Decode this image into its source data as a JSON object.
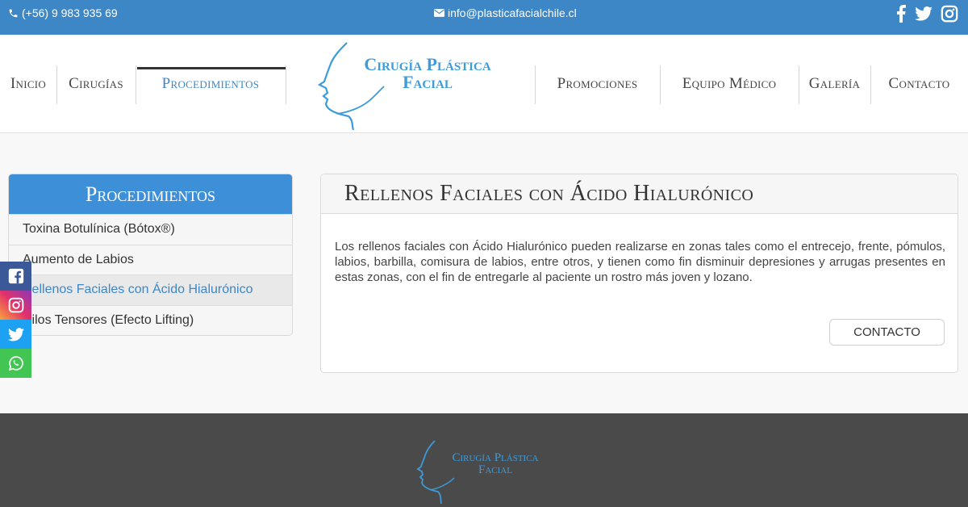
{
  "topbar": {
    "phone": "(+56) 9 983 935 69",
    "email": "info@plasticafacialchile.cl",
    "socials": [
      "facebook-icon",
      "twitter-icon",
      "instagram-icon"
    ]
  },
  "nav": {
    "items": [
      {
        "label": "Inicio"
      },
      {
        "label": "Cirugías"
      },
      {
        "label": "Procedimientos",
        "active": true
      },
      {
        "label": "Promociones"
      },
      {
        "label": "Equipo Médico"
      },
      {
        "label": "Galería"
      },
      {
        "label": "Contacto"
      }
    ]
  },
  "logo": {
    "line1": "Cirugía Plástica",
    "line2": "Facial"
  },
  "sidebar": {
    "title": "Procedimientos",
    "items": [
      {
        "label": "Toxina Botulínica (Bótox®)"
      },
      {
        "label": "Aumento de Labios"
      },
      {
        "label": "Rellenos Faciales con Ácido Hialurónico",
        "active": true
      },
      {
        "label": "Hilos Tensores (Efecto Lifting)"
      }
    ]
  },
  "float_social": [
    "facebook-icon",
    "instagram-icon",
    "twitter-icon",
    "whatsapp-icon"
  ],
  "main": {
    "title": "Rellenos Faciales con Ácido Hialurónico",
    "body": "Los rellenos faciales con Ácido Hialurónico pueden realizarse en zonas tales como el entrecejo, frente, pómulos, labios, barbilla, comisura de labios, entre otros, y tienen como fin disminuir depresiones y arrugas presentes en estas zonas, con el fin de entregarle al paciente un rostro más joven y lozano.",
    "button": "CONTACTO"
  },
  "colors": {
    "brand_blue": "#3d87c6",
    "logo_blue": "#3d9bd9",
    "footer_bg": "#4a4a4a"
  }
}
